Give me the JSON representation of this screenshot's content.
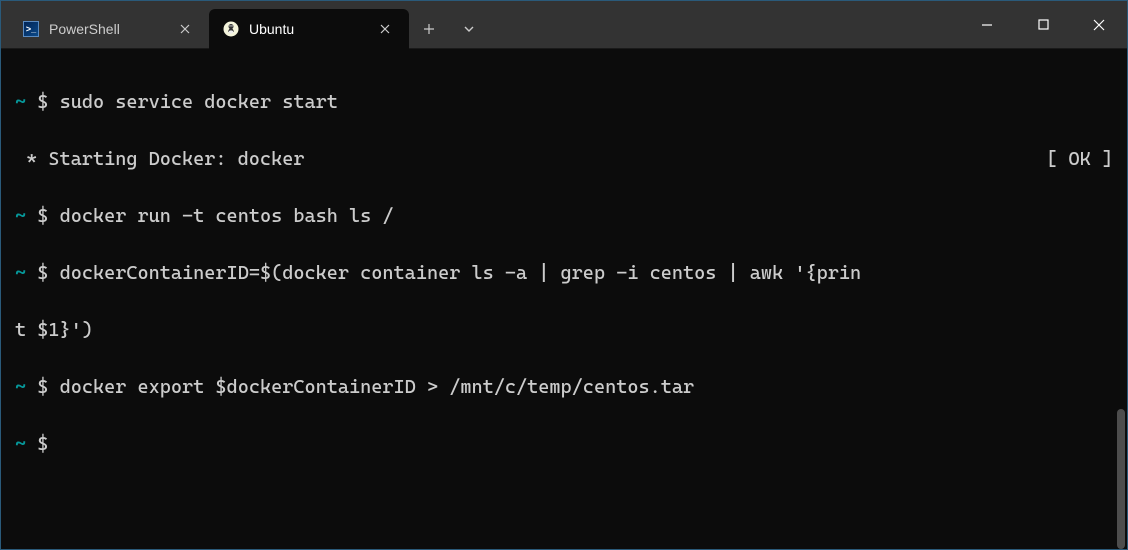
{
  "tabs": [
    {
      "label": "PowerShell",
      "active": false,
      "icon": "powershell"
    },
    {
      "label": "Ubuntu",
      "active": true,
      "icon": "ubuntu"
    }
  ],
  "terminal": {
    "prompt_cwd": "~",
    "prompt_symbol": "$",
    "lines": {
      "cmd1": "sudo service docker start",
      "out1_left": " * Starting Docker: docker",
      "out1_right": "[ OK ]",
      "cmd2": "docker run -t centos bash ls /",
      "cmd3a": "dockerContainerID=$(docker container ls -a | grep -i centos | awk '{prin",
      "cmd3b": "t $1}')",
      "cmd4": "docker export $dockerContainerID > /mnt/c/temp/centos.tar",
      "cmd5": ""
    }
  },
  "glyphs": {
    "close_x": "✕",
    "plus": "+",
    "chevron_down": "⌄",
    "minimize": "—",
    "maximize": "▢"
  }
}
